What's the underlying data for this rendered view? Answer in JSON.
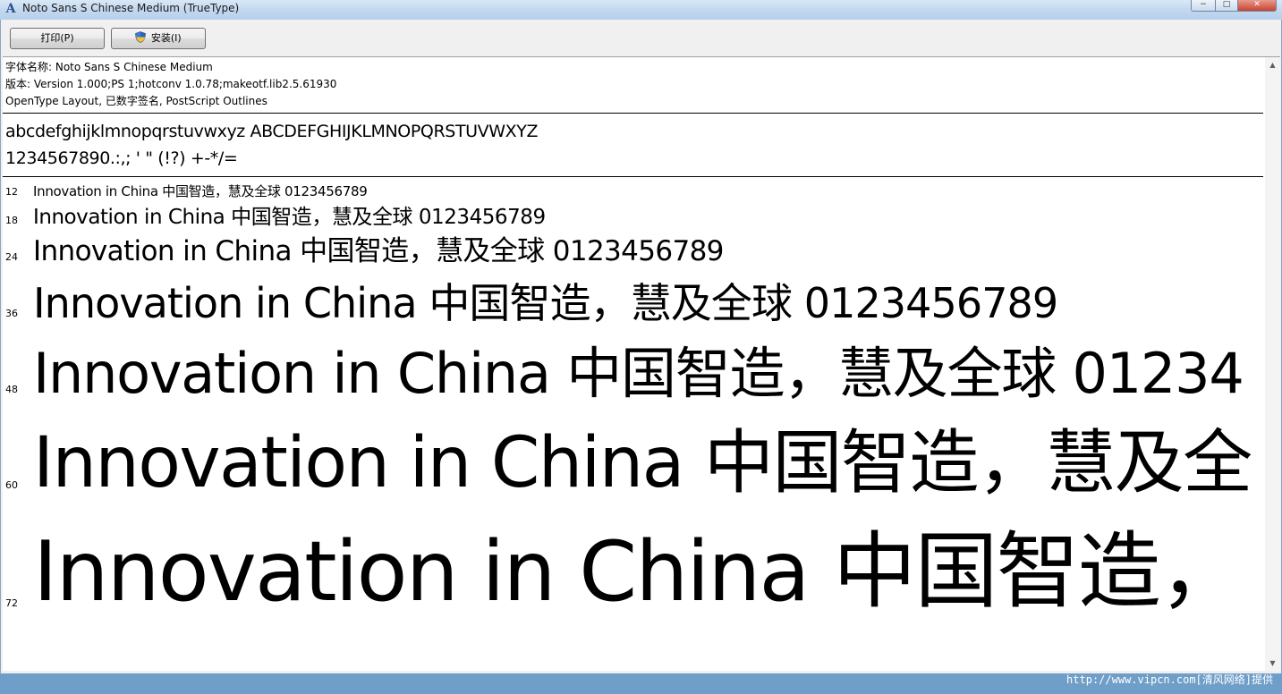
{
  "window": {
    "title": "Noto Sans S Chinese Medium (TrueType)",
    "buttons": {
      "minimize": "−",
      "maximize": "□",
      "close": "✕"
    }
  },
  "toolbar": {
    "print_label": "打印(P)",
    "install_label": "安装(I)"
  },
  "font_info": {
    "name_line": "字体名称: Noto Sans S Chinese Medium",
    "version_line": "版本: Version 1.000;PS 1;hotconv 1.0.78;makeotf.lib2.5.61930",
    "type_line": "OpenType Layout, 已数字签名, PostScript Outlines"
  },
  "charset": {
    "letters": "abcdefghijklmnopqrstuvwxyz ABCDEFGHIJKLMNOPQRSTUVWXYZ",
    "digits": "1234567890.:,; ' \" (!?) +-*/="
  },
  "samples": [
    {
      "size": "12",
      "text": "Innovation in China 中国智造，慧及全球 0123456789"
    },
    {
      "size": "18",
      "text": "Innovation in China 中国智造，慧及全球 0123456789"
    },
    {
      "size": "24",
      "text": "Innovation in China 中国智造，慧及全球 0123456789"
    },
    {
      "size": "36",
      "text": "Innovation in China 中国智造，慧及全球 0123456789"
    },
    {
      "size": "48",
      "text": "Innovation in China 中国智造，慧及全球 01234"
    },
    {
      "size": "60",
      "text": "Innovation in China 中国智造，慧及全"
    },
    {
      "size": "72",
      "text": "Innovation in China 中国智造，"
    }
  ],
  "scrollbar": {
    "up_icon": "▲",
    "down_icon": "▼"
  },
  "watermark": "http://www.vipcn.com[清风网络]提供",
  "colors": {
    "titlebar": "#c2d8ef",
    "frame": "#f0f0f0",
    "content": "#ffffff"
  }
}
